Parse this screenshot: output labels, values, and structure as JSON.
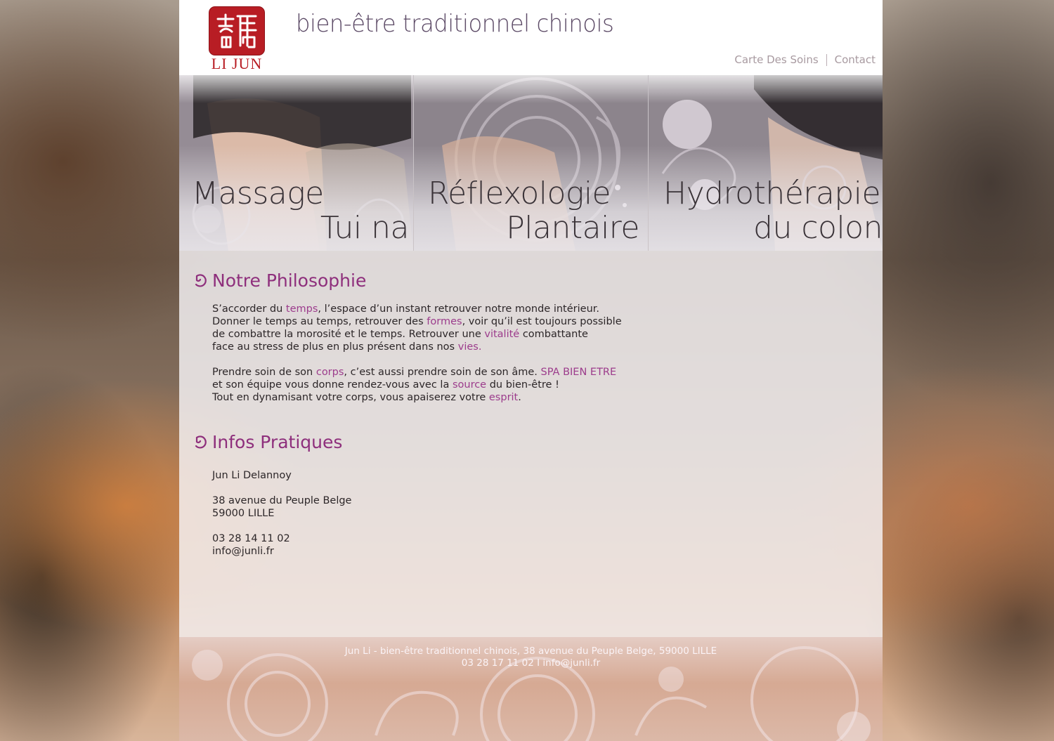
{
  "header": {
    "logo_text": "LI JUN",
    "tagline": "bien-être traditionnel chinois",
    "nav": [
      {
        "label": "Carte Des Soins"
      },
      {
        "label": "Contact"
      }
    ]
  },
  "services": [
    {
      "line1": "Massage",
      "line2": "Tui na"
    },
    {
      "line1": "Réflexologie",
      "line2": "Plantaire"
    },
    {
      "line1": "Hydrothérapie",
      "line2": "du colon"
    }
  ],
  "philosophy": {
    "title": "Notre Philosophie",
    "p1": {
      "a": "S’accorder du ",
      "temps": "temps",
      "b": ", l’espace d’un instant retrouver notre monde intérieur.",
      "c": "Donner le temps au temps, retrouver des ",
      "formes": "formes",
      "d": ", voir qu’il est toujours possible",
      "e": "de combattre la morosité et le temps. Retrouver une ",
      "vitalite": "vitalité",
      "f": " combattante",
      "g": "face au stress de plus en plus présent dans nos ",
      "vies": "vies",
      "h": "."
    },
    "p2": {
      "a": "Prendre soin de son ",
      "corps": "corps",
      "b": ", c’est aussi prendre soin de son âme. ",
      "spa": "SPA BIEN ETRE",
      "c": "et son équipe vous donne rendez-vous avec la ",
      "source": "source",
      "d": " du bien-être !",
      "e": "Tout en dynamisant votre corps, vous apaiserez votre ",
      "esprit": "esprit",
      "f": "."
    }
  },
  "infos": {
    "title": "Infos Pratiques",
    "name": "Jun Li Delannoy",
    "street": "38 avenue du Peuple Belge",
    "city": "59000 LILLE",
    "phone": "03 28 14 11 02",
    "email": "info@junli.fr"
  },
  "footer": {
    "line1": "Jun Li - bien-être traditionnel chinois, 38 avenue du Peuple Belge, 59000 LILLE",
    "line2": "03 28 17 11 02  I  info@junli.fr"
  },
  "colors": {
    "accent": "#8e2f7c",
    "highlight": "#9c3c8c",
    "logo_red": "#b81d24"
  }
}
